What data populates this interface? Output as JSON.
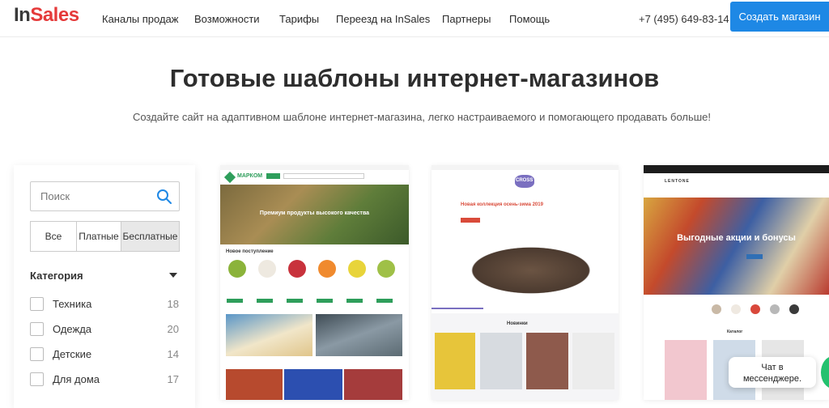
{
  "header": {
    "logo_in": "In",
    "logo_sales": "Sales",
    "nav": [
      "Каналы продаж",
      "Возможности",
      "Тарифы",
      "Переезд на InSales",
      "Партнеры",
      "Помощь"
    ],
    "phone": "+7 (495) 649-83-14",
    "cta": "Создать магазин"
  },
  "hero": {
    "title": "Готовые шаблоны интернет-магазинов",
    "subtitle": "Создайте сайт на адаптивном шаблоне интернет-магазина, легко настраиваемого и помогающего продавать больше!"
  },
  "filters": {
    "search_placeholder": "Поиск",
    "segments": [
      "Все",
      "Платные",
      "Бесплатные"
    ],
    "category_title": "Категория",
    "categories": [
      {
        "label": "Техника",
        "count": "18"
      },
      {
        "label": "Одежда",
        "count": "20"
      },
      {
        "label": "Детские",
        "count": "14"
      },
      {
        "label": "Для дома",
        "count": "17"
      }
    ]
  },
  "templates": {
    "t1": {
      "brand": "МАРКОМ",
      "banner": "Премиум продукты высокого качества",
      "section": "Новое поступление"
    },
    "t2": {
      "brand": "CROSS",
      "banner": "Новая коллекция осень-зима 2019",
      "section": "Новинки"
    },
    "t3": {
      "brand": "LENTONE",
      "banner": "Выгодные акции и бонусы",
      "section": "Каталог"
    }
  },
  "chat": {
    "line1": "Чат в",
    "line2": "мессенджере."
  },
  "colors": {
    "accent": "#1e88e5",
    "logo_red": "#e53a3a",
    "green": "#2e9e5b"
  }
}
